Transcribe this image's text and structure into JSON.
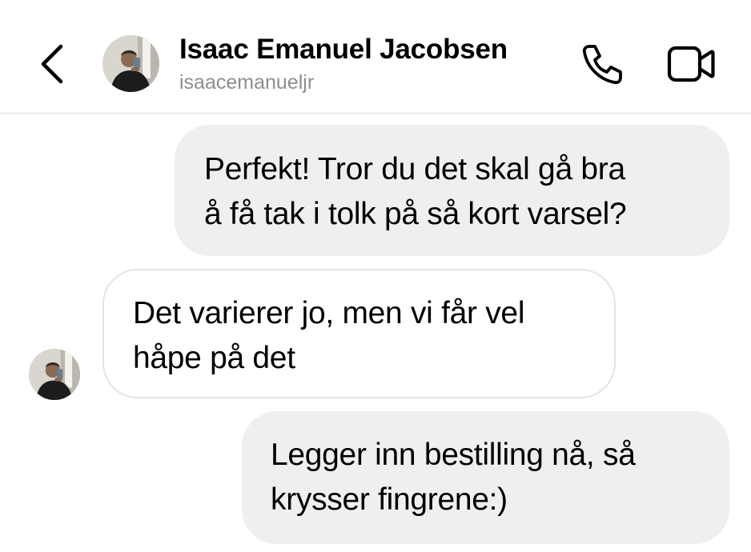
{
  "header": {
    "contact_name": "Isaac Emanuel Jacobsen",
    "username": "isaacemanueljr",
    "back_icon": "chevron-left-icon",
    "call_icon": "phone-icon",
    "video_icon": "video-camera-icon"
  },
  "messages": [
    {
      "direction": "outgoing",
      "lines": [
        "Perfekt! Tror du det skal gå bra",
        "å få tak i tolk på så kort varsel?"
      ]
    },
    {
      "direction": "incoming",
      "lines": [
        "Det varierer jo, men vi får vel",
        "håpe på det"
      ]
    },
    {
      "direction": "outgoing",
      "lines": [
        "Legger inn bestilling nå, så",
        "krysser fingrene:)"
      ]
    }
  ],
  "colors": {
    "outgoing_bubble": "#efefef",
    "incoming_border": "#e4e4e4",
    "secondary_text": "#8e8e8e",
    "divider": "#dbdbdb"
  }
}
